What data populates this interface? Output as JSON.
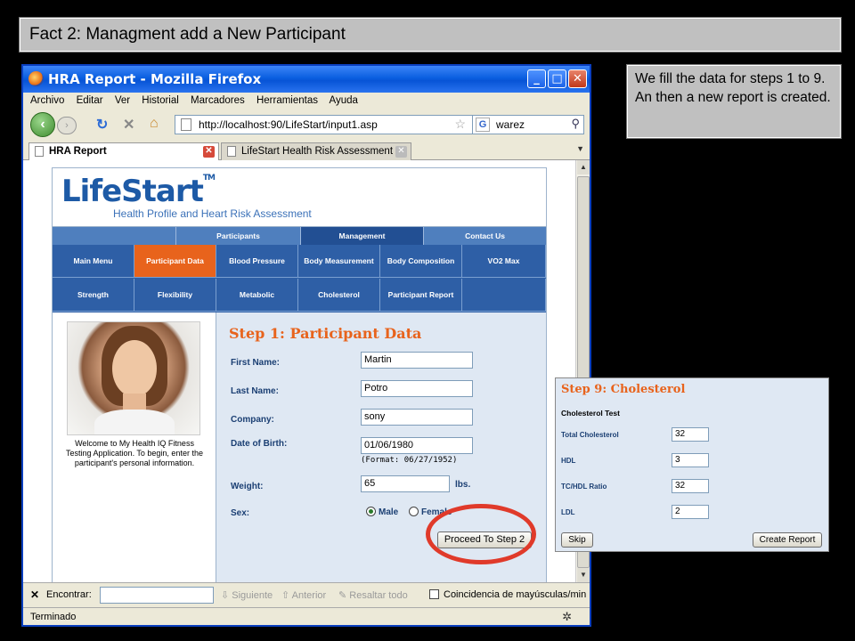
{
  "slide": {
    "title": "Fact 2: Managment add a New Participant",
    "note": "We fill the data for steps 1 to 9. An then a new report is created."
  },
  "browser": {
    "window_title": "HRA Report - Mozilla Firefox",
    "menu": [
      "Archivo",
      "Editar",
      "Ver",
      "Historial",
      "Marcadores",
      "Herramientas",
      "Ayuda"
    ],
    "url": "http://localhost:90/LifeStart/input1.asp",
    "search_value": "warez",
    "search_engine_icon": "G",
    "tabs": [
      {
        "label": "HRA Report",
        "active": true
      },
      {
        "label": "LifeStart Health Risk Assessment",
        "active": false
      }
    ],
    "findbar": {
      "label": "Encontrar:",
      "next": "Siguiente",
      "prev": "Anterior",
      "highlight": "Resaltar todo",
      "match_case": "Coincidencia de mayúsculas/minúsculas"
    },
    "status": "Terminado"
  },
  "site": {
    "logo": "LifeStart",
    "logo_tm": "TM",
    "tagline": "Health Profile and Heart Risk Assessment",
    "top_nav": [
      {
        "label": "Participants",
        "selected": false
      },
      {
        "label": "Management",
        "selected": true
      },
      {
        "label": "Contact Us",
        "selected": false
      }
    ],
    "main_nav_row1": [
      {
        "label": "Main Menu",
        "selected": false
      },
      {
        "label": "Participant Data",
        "selected": true
      },
      {
        "label": "Blood Pressure",
        "selected": false
      },
      {
        "label": "Body Measurement",
        "selected": false
      },
      {
        "label": "Body Composition",
        "selected": false
      },
      {
        "label": "VO2 Max",
        "selected": false
      }
    ],
    "main_nav_row2": [
      {
        "label": "Strength",
        "selected": false
      },
      {
        "label": "Flexibility",
        "selected": false
      },
      {
        "label": "Metabolic",
        "selected": false
      },
      {
        "label": "Cholesterol",
        "selected": false
      },
      {
        "label": "Participant Report",
        "selected": false
      },
      {
        "label": "",
        "selected": false
      }
    ],
    "welcome": "Welcome to My Health IQ Fitness Testing Application. To begin, enter the participant's personal information."
  },
  "step1": {
    "title": "Step 1: Participant Data",
    "first_name_label": "First Name:",
    "first_name": "Martin",
    "last_name_label": "Last Name:",
    "last_name": "Potro",
    "company_label": "Company:",
    "company": "sony",
    "dob_label": "Date of Birth:",
    "dob": "01/06/1980",
    "dob_format": "(Format: 06/27/1952)",
    "weight_label": "Weight:",
    "weight": "65",
    "weight_unit": "lbs.",
    "sex_label": "Sex:",
    "sex_male": "Male",
    "sex_female": "Female",
    "sex_selected": "Male",
    "proceed_button": "Proceed To Step 2"
  },
  "step9": {
    "title": "Step 9: Cholesterol",
    "subtitle": "Cholesterol Test",
    "fields": [
      {
        "label": "Total Cholesterol",
        "value": "32"
      },
      {
        "label": "HDL",
        "value": "3"
      },
      {
        "label": "TC/HDL Ratio",
        "value": "32"
      },
      {
        "label": "LDL",
        "value": "2"
      }
    ],
    "skip_button": "Skip",
    "create_button": "Create Report"
  },
  "colors": {
    "accent_orange": "#e8631c",
    "nav_blue": "#2e5fa6",
    "annotation_red": "#e03a2a"
  }
}
